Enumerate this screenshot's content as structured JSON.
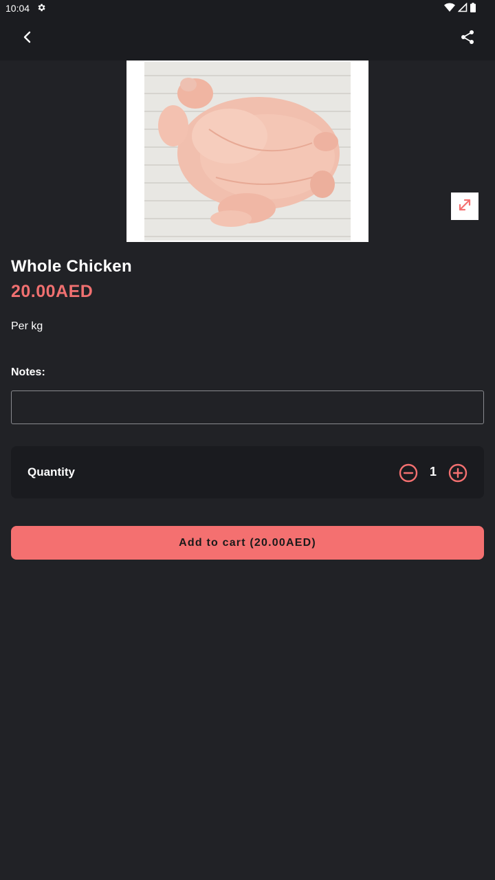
{
  "status_bar": {
    "time": "10:04",
    "icons": [
      "settings-gear-icon",
      "wifi-icon",
      "signal-icon",
      "battery-icon"
    ]
  },
  "app_bar": {
    "back_icon": "chevron-left-icon",
    "share_icon": "share-icon"
  },
  "product": {
    "name": "Whole Chicken",
    "price": "20.00AED",
    "unit": "Per kg",
    "image_icon": "whole-chicken-photo",
    "expand_icon": "expand-diagonal-icon"
  },
  "notes": {
    "label": "Notes:",
    "value": "",
    "placeholder": ""
  },
  "quantity": {
    "label": "Quantity",
    "value": "1",
    "minus_icon": "minus-circle-icon",
    "plus_icon": "plus-circle-icon"
  },
  "cart_button": {
    "label": "Add to cart (20.00AED)"
  },
  "colors": {
    "background": "#212226",
    "bar": "#1b1c20",
    "accent": "#f47070",
    "price": "#f07070"
  }
}
